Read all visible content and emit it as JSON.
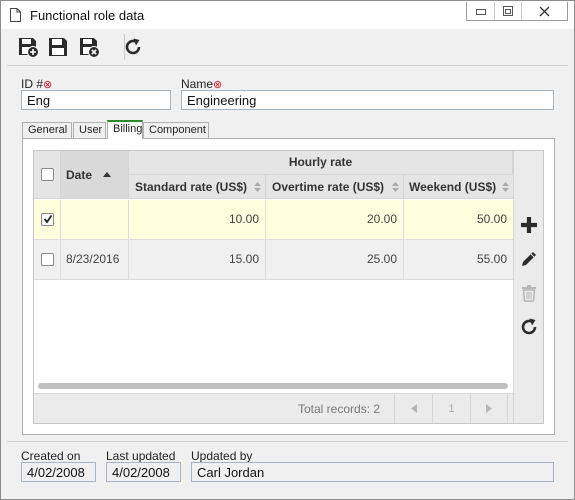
{
  "window": {
    "title": "Functional role data"
  },
  "form": {
    "id_label": "ID #",
    "id_value": "Eng",
    "name_label": "Name",
    "name_value": "Engineering",
    "required_mark": "⊗"
  },
  "tabs": [
    {
      "label": "General"
    },
    {
      "label": "User"
    },
    {
      "label": "Billing"
    },
    {
      "label": "Component"
    }
  ],
  "grid": {
    "group_header": "Hourly rate",
    "columns": {
      "date": "Date",
      "standard": "Standard rate (US$)",
      "overtime": "Overtime rate (US$)",
      "weekend": "Weekend (US$)"
    },
    "rows": [
      {
        "checked": true,
        "date": "",
        "standard": "10.00",
        "overtime": "20.00",
        "weekend": "50.00"
      },
      {
        "checked": false,
        "date": "8/23/2016",
        "standard": "15.00",
        "overtime": "25.00",
        "weekend": "55.00"
      }
    ],
    "total_records": "Total records: 2",
    "page": "1"
  },
  "meta": {
    "created_label": "Created on",
    "created_value": "4/02/2008",
    "updated_label": "Last updated",
    "updated_value": "4/02/2008",
    "updated_by_label": "Updated by",
    "updated_by_value": "Carl Jordan"
  },
  "icons": {
    "toolbar": [
      "save-new-icon",
      "save-icon",
      "save-close-icon",
      "refresh-icon"
    ],
    "side": [
      "add-icon",
      "edit-icon",
      "delete-icon",
      "refresh-icon"
    ]
  },
  "colors": {
    "selected_row": "#ffffdd",
    "accent_tab": "#2a8a2a"
  }
}
